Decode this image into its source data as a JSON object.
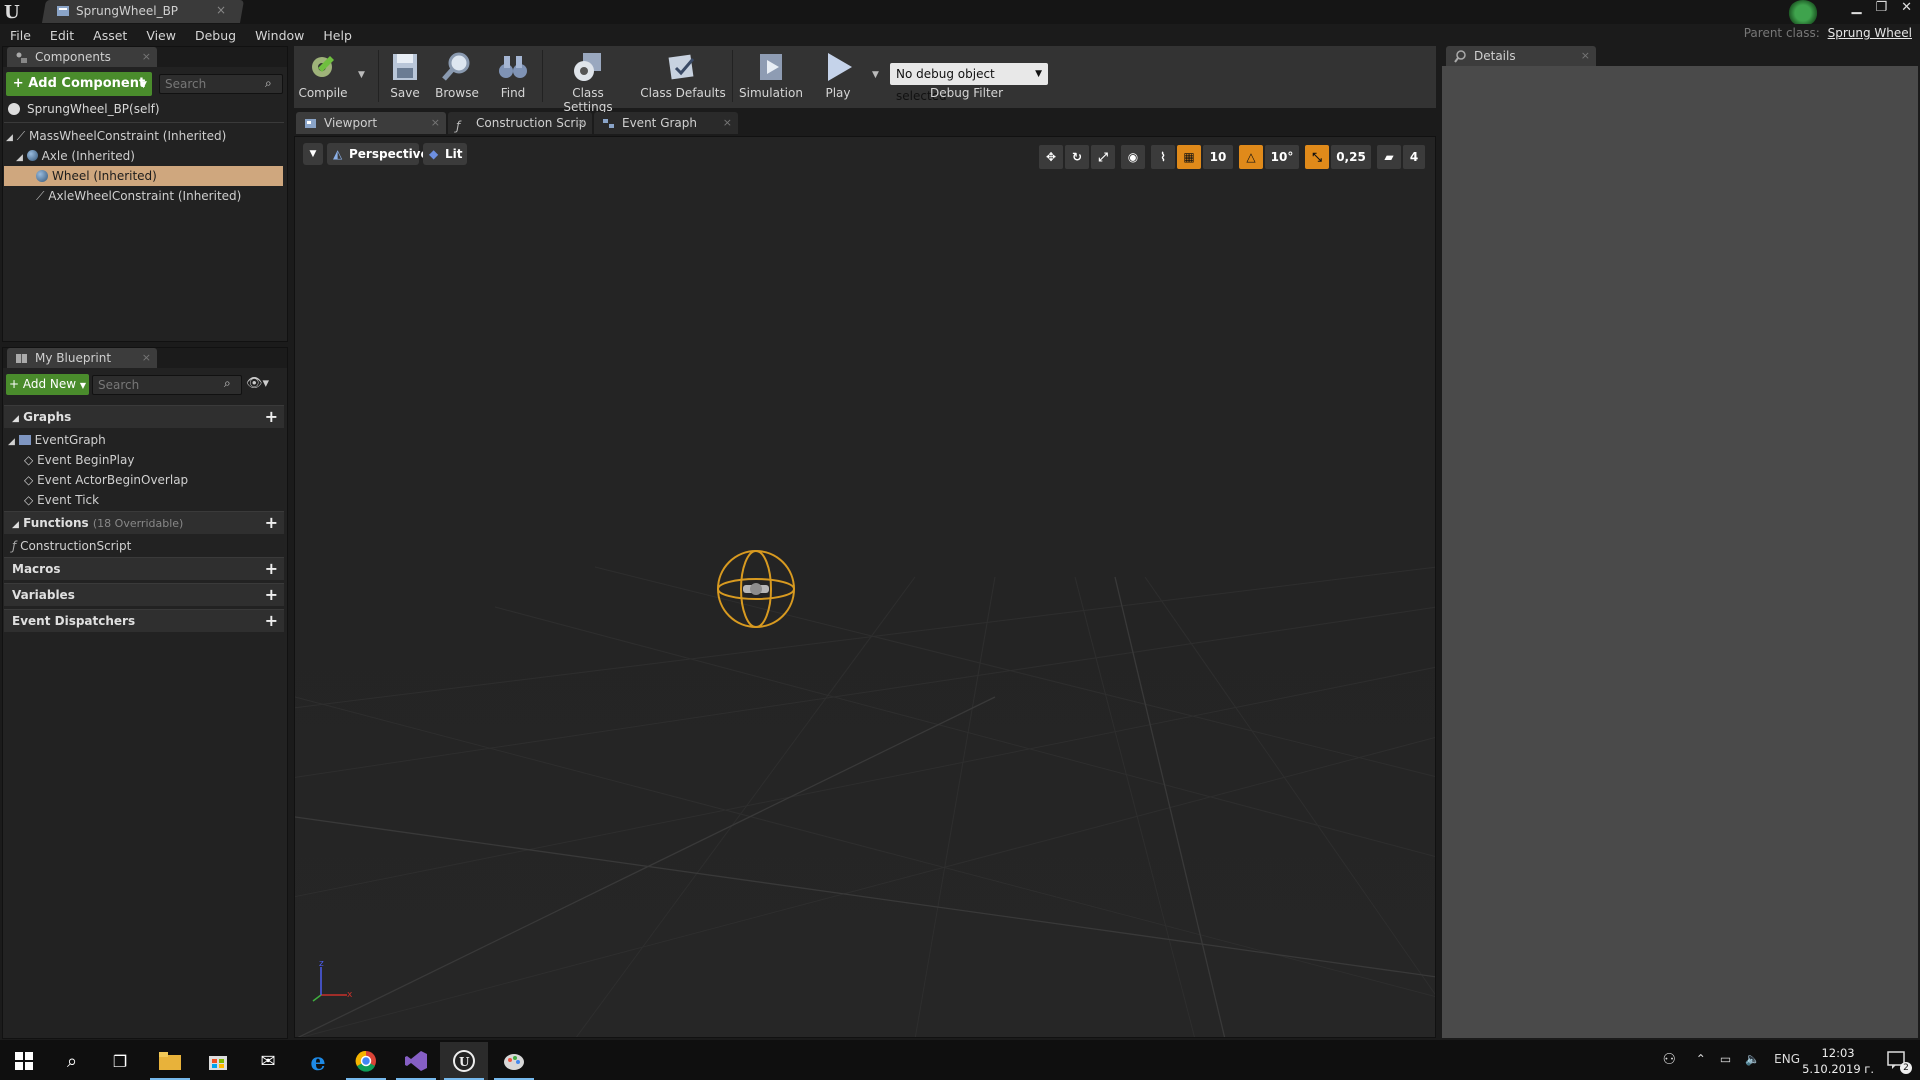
{
  "window": {
    "tab_title": "SprungWheel_BP",
    "parent_class_label": "Parent class:",
    "parent_class_value": "Sprung Wheel"
  },
  "menu": [
    "File",
    "Edit",
    "Asset",
    "View",
    "Debug",
    "Window",
    "Help"
  ],
  "components": {
    "tab_label": "Components",
    "add_button": "+ Add Component",
    "search_placeholder": "Search",
    "self_label": "SprungWheel_BP(self)",
    "tree": [
      {
        "label": "MassWheelConstraint (Inherited)",
        "selected": false
      },
      {
        "label": "Axle (Inherited)",
        "selected": false
      },
      {
        "label": "Wheel (Inherited)",
        "selected": true
      },
      {
        "label": "AxleWheelConstraint (Inherited)",
        "selected": false
      }
    ]
  },
  "my_blueprint": {
    "tab_label": "My Blueprint",
    "add_button": "Add New",
    "search_placeholder": "Search",
    "graphs_label": "Graphs",
    "event_graph": "EventGraph",
    "events": [
      "Event BeginPlay",
      "Event ActorBeginOverlap",
      "Event Tick"
    ],
    "functions_label": "Functions",
    "functions_note": "(18 Overridable)",
    "construction_script": "ConstructionScript",
    "macros_label": "Macros",
    "variables_label": "Variables",
    "dispatchers_label": "Event Dispatchers"
  },
  "toolbar": {
    "compile": "Compile",
    "save": "Save",
    "browse": "Browse",
    "find": "Find",
    "class_settings": "Class Settings",
    "class_defaults": "Class Defaults",
    "simulation": "Simulation",
    "play": "Play",
    "debug_select": "No debug object selected",
    "debug_filter": "Debug Filter"
  },
  "editor_tabs": [
    "Viewport",
    "Construction Scrip",
    "Event Graph"
  ],
  "viewport": {
    "perspective": "Perspective",
    "lit": "Lit",
    "grid_snap": "10",
    "rotation_snap": "10°",
    "scale_snap": "0,25",
    "camera_speed": "4"
  },
  "details": {
    "tab_label": "Details"
  },
  "taskbar": {
    "language": "ENG",
    "time": "12:03",
    "date": "5.10.2019 г.",
    "notification_count": "2"
  },
  "colors": {
    "accent_green": "#4a8c2c",
    "selection": "#cfa77e",
    "snap_orange": "#e08a1a",
    "wheel_wire": "#d89a20"
  }
}
